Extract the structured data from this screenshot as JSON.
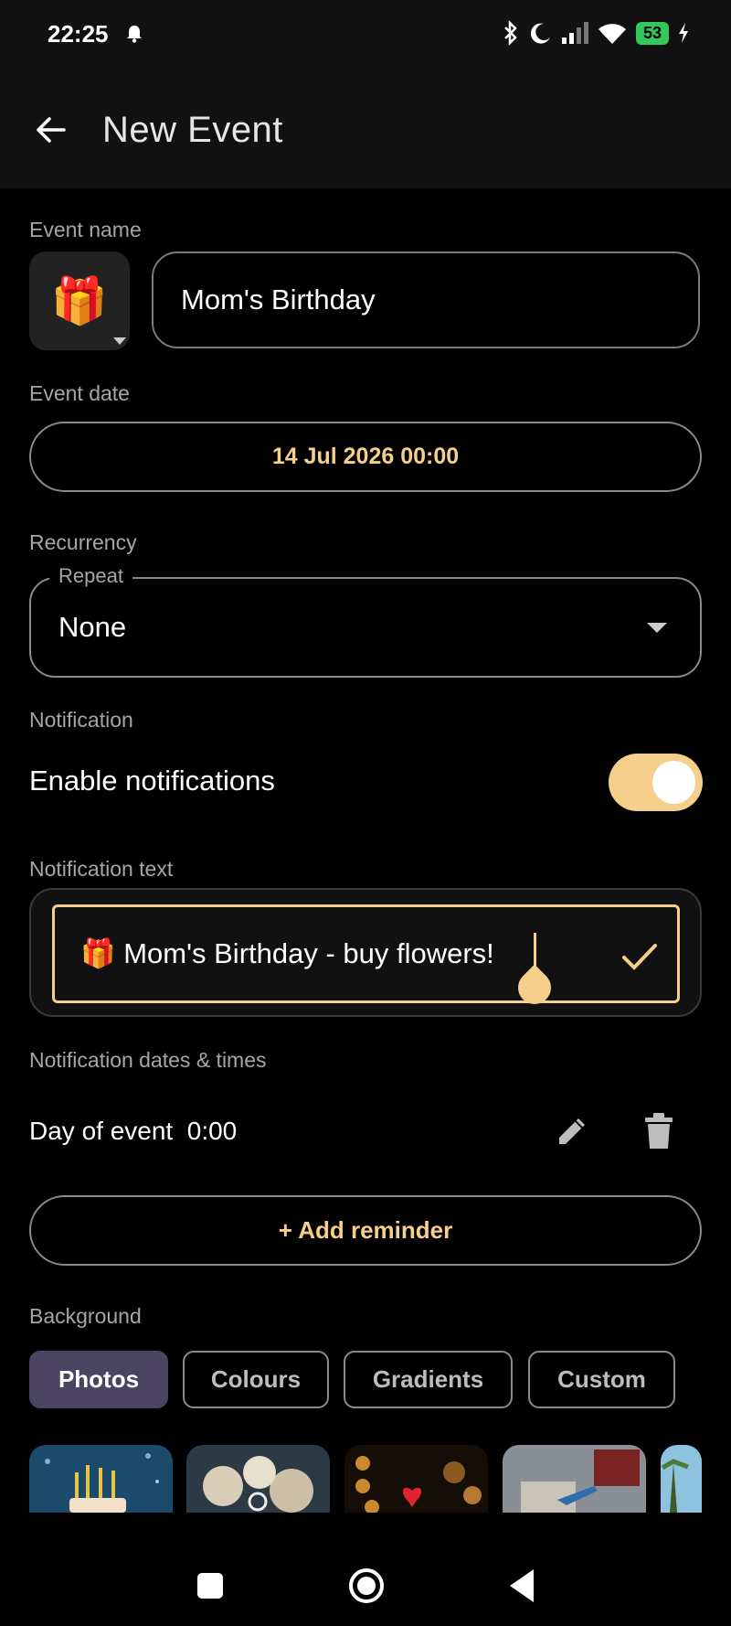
{
  "status_bar": {
    "time": "22:25",
    "battery": "53",
    "icons": [
      "bell-icon",
      "bluetooth-icon",
      "moon-icon",
      "signal-icon",
      "wifi-icon",
      "battery-icon",
      "charging-icon"
    ]
  },
  "app_bar": {
    "title": "New Event"
  },
  "event_name": {
    "label": "Event name",
    "emoji": "🎁",
    "value": "Mom's Birthday"
  },
  "event_date": {
    "label": "Event date",
    "value": "14 Jul 2026 00:00"
  },
  "recurrency": {
    "label": "Recurrency",
    "field_label": "Repeat",
    "value": "None"
  },
  "notification": {
    "label": "Notification",
    "enable_label": "Enable notifications",
    "enabled": true,
    "text_label": "Notification text",
    "text_value": "🎁 Mom's Birthday - buy flowers!"
  },
  "notification_times": {
    "label": "Notification dates & times",
    "items": [
      {
        "text": "Day of event  0:00"
      }
    ],
    "add_button": "+ Add reminder"
  },
  "background": {
    "label": "Background",
    "tabs": [
      "Photos",
      "Colours",
      "Gradients",
      "Custom"
    ],
    "selected_tab": "Photos"
  },
  "colors": {
    "accent": "#f5cf8b",
    "chip_selected": "#4a4460",
    "background": "#000000"
  }
}
